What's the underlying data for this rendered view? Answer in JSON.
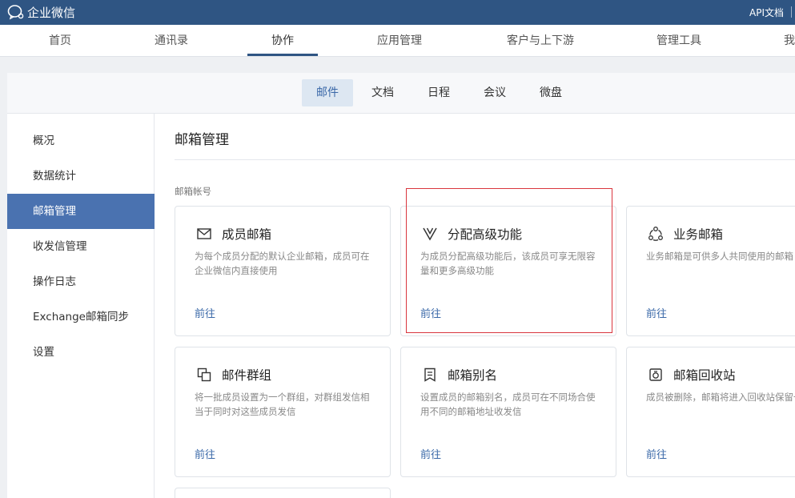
{
  "app": {
    "title": "企业微信",
    "api_link": "API文档"
  },
  "main_nav": {
    "items": [
      {
        "label": "首页"
      },
      {
        "label": "通讯录"
      },
      {
        "label": "协作"
      },
      {
        "label": "应用管理"
      },
      {
        "label": "客户与上下游"
      },
      {
        "label": "管理工具"
      },
      {
        "label": "我"
      }
    ],
    "active": "协作"
  },
  "sub_nav": {
    "tabs": [
      {
        "label": "邮件"
      },
      {
        "label": "文档"
      },
      {
        "label": "日程"
      },
      {
        "label": "会议"
      },
      {
        "label": "微盘"
      }
    ],
    "active": "邮件"
  },
  "sidebar": {
    "items": [
      {
        "label": "概况"
      },
      {
        "label": "数据统计"
      },
      {
        "label": "邮箱管理"
      },
      {
        "label": "收发信管理"
      },
      {
        "label": "操作日志"
      },
      {
        "label": "Exchange邮箱同步"
      },
      {
        "label": "设置"
      }
    ],
    "active": "邮箱管理"
  },
  "main": {
    "title": "邮箱管理",
    "section_label": "邮箱帐号",
    "cards": [
      {
        "title": "成员邮箱",
        "desc": "为每个成员分配的默认企业邮箱，成员可在企业微信内直接使用",
        "link": "前往",
        "icon": "envelope-icon"
      },
      {
        "title": "分配高级功能",
        "desc": "为成员分配高级功能后，该成员可享无限容量和更多高级功能",
        "link": "前往",
        "icon": "v-badge-icon"
      },
      {
        "title": "业务邮箱",
        "desc": "业务邮箱是可供多人共同使用的邮箱",
        "link": "前往",
        "icon": "shared-circle-icon"
      },
      {
        "title": "邮件群组",
        "desc": "将一批成员设置为一个群组，对群组发信相当于同时对这些成员发信",
        "link": "前往",
        "icon": "group-icon"
      },
      {
        "title": "邮箱别名",
        "desc": "设置成员的邮箱别名，成员可在不同场合使用不同的邮箱地址收发信",
        "link": "前往",
        "icon": "alias-icon"
      },
      {
        "title": "邮箱回收站",
        "desc": "成员被删除，邮箱将进入回收站保留一段时间，管理员可以对邮箱再处理",
        "link": "前往",
        "icon": "recycle-bin-icon"
      }
    ]
  }
}
